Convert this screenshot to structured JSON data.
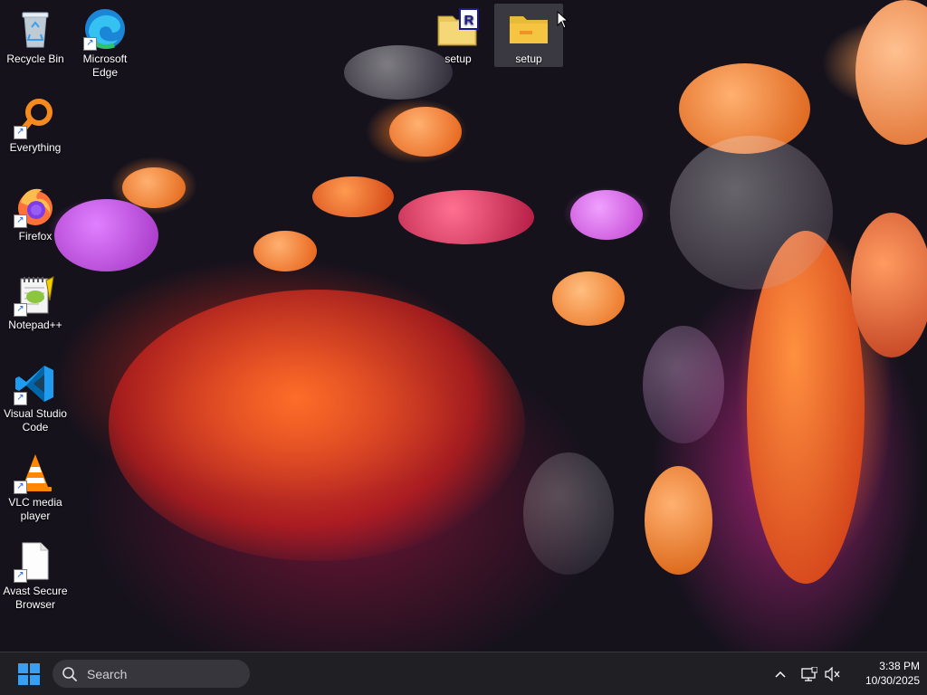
{
  "desktop": {
    "icons": [
      {
        "id": "recycle-bin",
        "label": "Recycle Bin",
        "icon": "recycle-bin-icon",
        "shortcut": false
      },
      {
        "id": "microsoft-edge",
        "label": "Microsoft Edge",
        "icon": "edge-icon",
        "shortcut": true
      },
      {
        "id": "everything",
        "label": "Everything",
        "icon": "magnifier-icon",
        "shortcut": true
      },
      {
        "id": "firefox",
        "label": "Firefox",
        "icon": "firefox-icon",
        "shortcut": true
      },
      {
        "id": "notepadpp",
        "label": "Notepad++",
        "icon": "notepadpp-icon",
        "shortcut": true
      },
      {
        "id": "vscode",
        "label": "Visual Studio Code",
        "icon": "vscode-icon",
        "shortcut": true
      },
      {
        "id": "vlc",
        "label": "VLC media player",
        "icon": "vlc-cone-icon",
        "shortcut": true
      },
      {
        "id": "avast",
        "label": "Avast Secure Browser",
        "icon": "blank-file-icon",
        "shortcut": true
      },
      {
        "id": "setup-rar",
        "label": "setup",
        "icon": "winrar-archive-icon",
        "shortcut": false
      },
      {
        "id": "setup-folder",
        "label": "setup",
        "icon": "folder-icon",
        "shortcut": false,
        "selected": true
      }
    ]
  },
  "taskbar": {
    "start_icon": "windows-logo-icon",
    "search": {
      "placeholder": "Search",
      "icon": "search-icon"
    },
    "tray": {
      "overflow_icon": "chevron-up-icon",
      "network_icon": "network-icon",
      "volume_icon": "volume-muted-icon"
    },
    "clock": {
      "time": "3:38 PM",
      "date": "10/30/2025"
    }
  },
  "colors": {
    "taskbar_bg": "#1f1f24",
    "search_bg": "#36363c",
    "windows_blue": "#3a9ff0",
    "folder_yellow": "#f5c542"
  }
}
